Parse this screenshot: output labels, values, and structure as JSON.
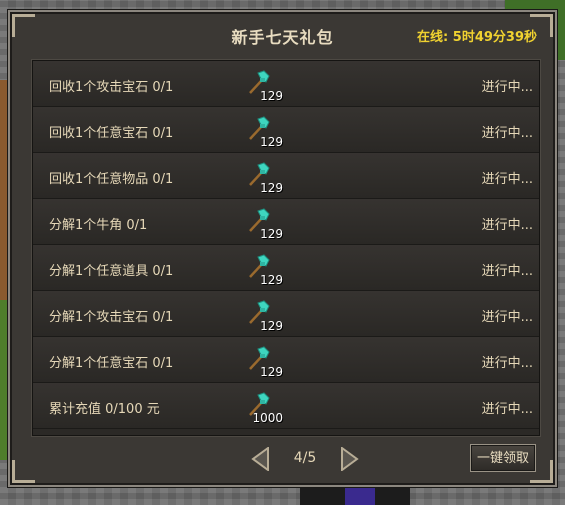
{
  "window": {
    "title": "新手七天礼包",
    "online_label": "在线: 5时49分39秒"
  },
  "tasks": [
    {
      "label": "回收1个攻击宝石 0/1",
      "reward_icon": "diamond-axe-icon",
      "reward_count": "129",
      "status": "进行中..."
    },
    {
      "label": "回收1个任意宝石 0/1",
      "reward_icon": "diamond-axe-icon",
      "reward_count": "129",
      "status": "进行中..."
    },
    {
      "label": "回收1个任意物品 0/1",
      "reward_icon": "diamond-axe-icon",
      "reward_count": "129",
      "status": "进行中..."
    },
    {
      "label": "分解1个牛角 0/1",
      "reward_icon": "diamond-axe-icon",
      "reward_count": "129",
      "status": "进行中..."
    },
    {
      "label": "分解1个任意道具 0/1",
      "reward_icon": "diamond-axe-icon",
      "reward_count": "129",
      "status": "进行中..."
    },
    {
      "label": "分解1个攻击宝石 0/1",
      "reward_icon": "diamond-axe-icon",
      "reward_count": "129",
      "status": "进行中..."
    },
    {
      "label": "分解1个任意宝石 0/1",
      "reward_icon": "diamond-axe-icon",
      "reward_count": "129",
      "status": "进行中..."
    },
    {
      "label": "累计充值 0/100 元",
      "reward_icon": "diamond-axe-icon",
      "reward_count": "1000",
      "status": "进行中..."
    }
  ],
  "pager": {
    "page_label": "4/5"
  },
  "footer": {
    "claim_label": "一键领取"
  },
  "colors": {
    "title": "#e8dcc0",
    "online": "#f0d230",
    "axe": "#3ed6c0"
  }
}
